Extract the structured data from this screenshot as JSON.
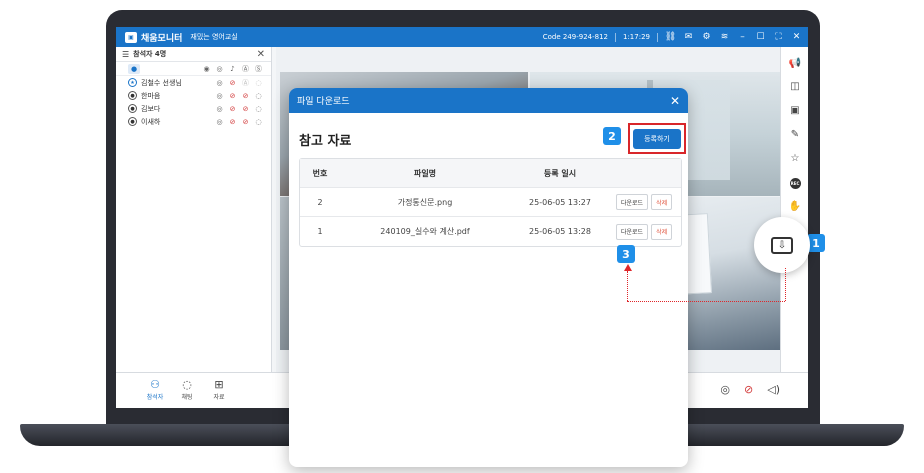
{
  "app": {
    "name": "채움모니터",
    "room": "재밌는 영어교실",
    "code": "Code 249-924-812",
    "time": "1:17:29",
    "brand_color": "#1a74c8"
  },
  "participants_panel": {
    "title": "참석자 4명",
    "people": [
      {
        "name": "김철수 선생님",
        "role": "host"
      },
      {
        "name": "한마음",
        "role": "student"
      },
      {
        "name": "김보다",
        "role": "student"
      },
      {
        "name": "이새하",
        "role": "student"
      }
    ]
  },
  "bottom_tabs": [
    {
      "label": "참석자",
      "icon": "people-icon"
    },
    {
      "label": "채팅",
      "icon": "chat-icon"
    },
    {
      "label": "자료",
      "icon": "files-icon"
    }
  ],
  "dialog": {
    "header": "파일 다운로드",
    "title": "참고 자료",
    "register_label": "등록하기",
    "columns": [
      "번호",
      "파일명",
      "등록 일시"
    ],
    "rows": [
      {
        "no": "2",
        "name": "가정통신문.png",
        "date": "25-06-05 13:27"
      },
      {
        "no": "1",
        "name": "240109_실수와 계산.pdf",
        "date": "25-06-05 13:28"
      }
    ],
    "download_label": "다운로드",
    "delete_label": "삭제"
  },
  "callouts": {
    "one": "1",
    "two": "2",
    "three": "3"
  }
}
